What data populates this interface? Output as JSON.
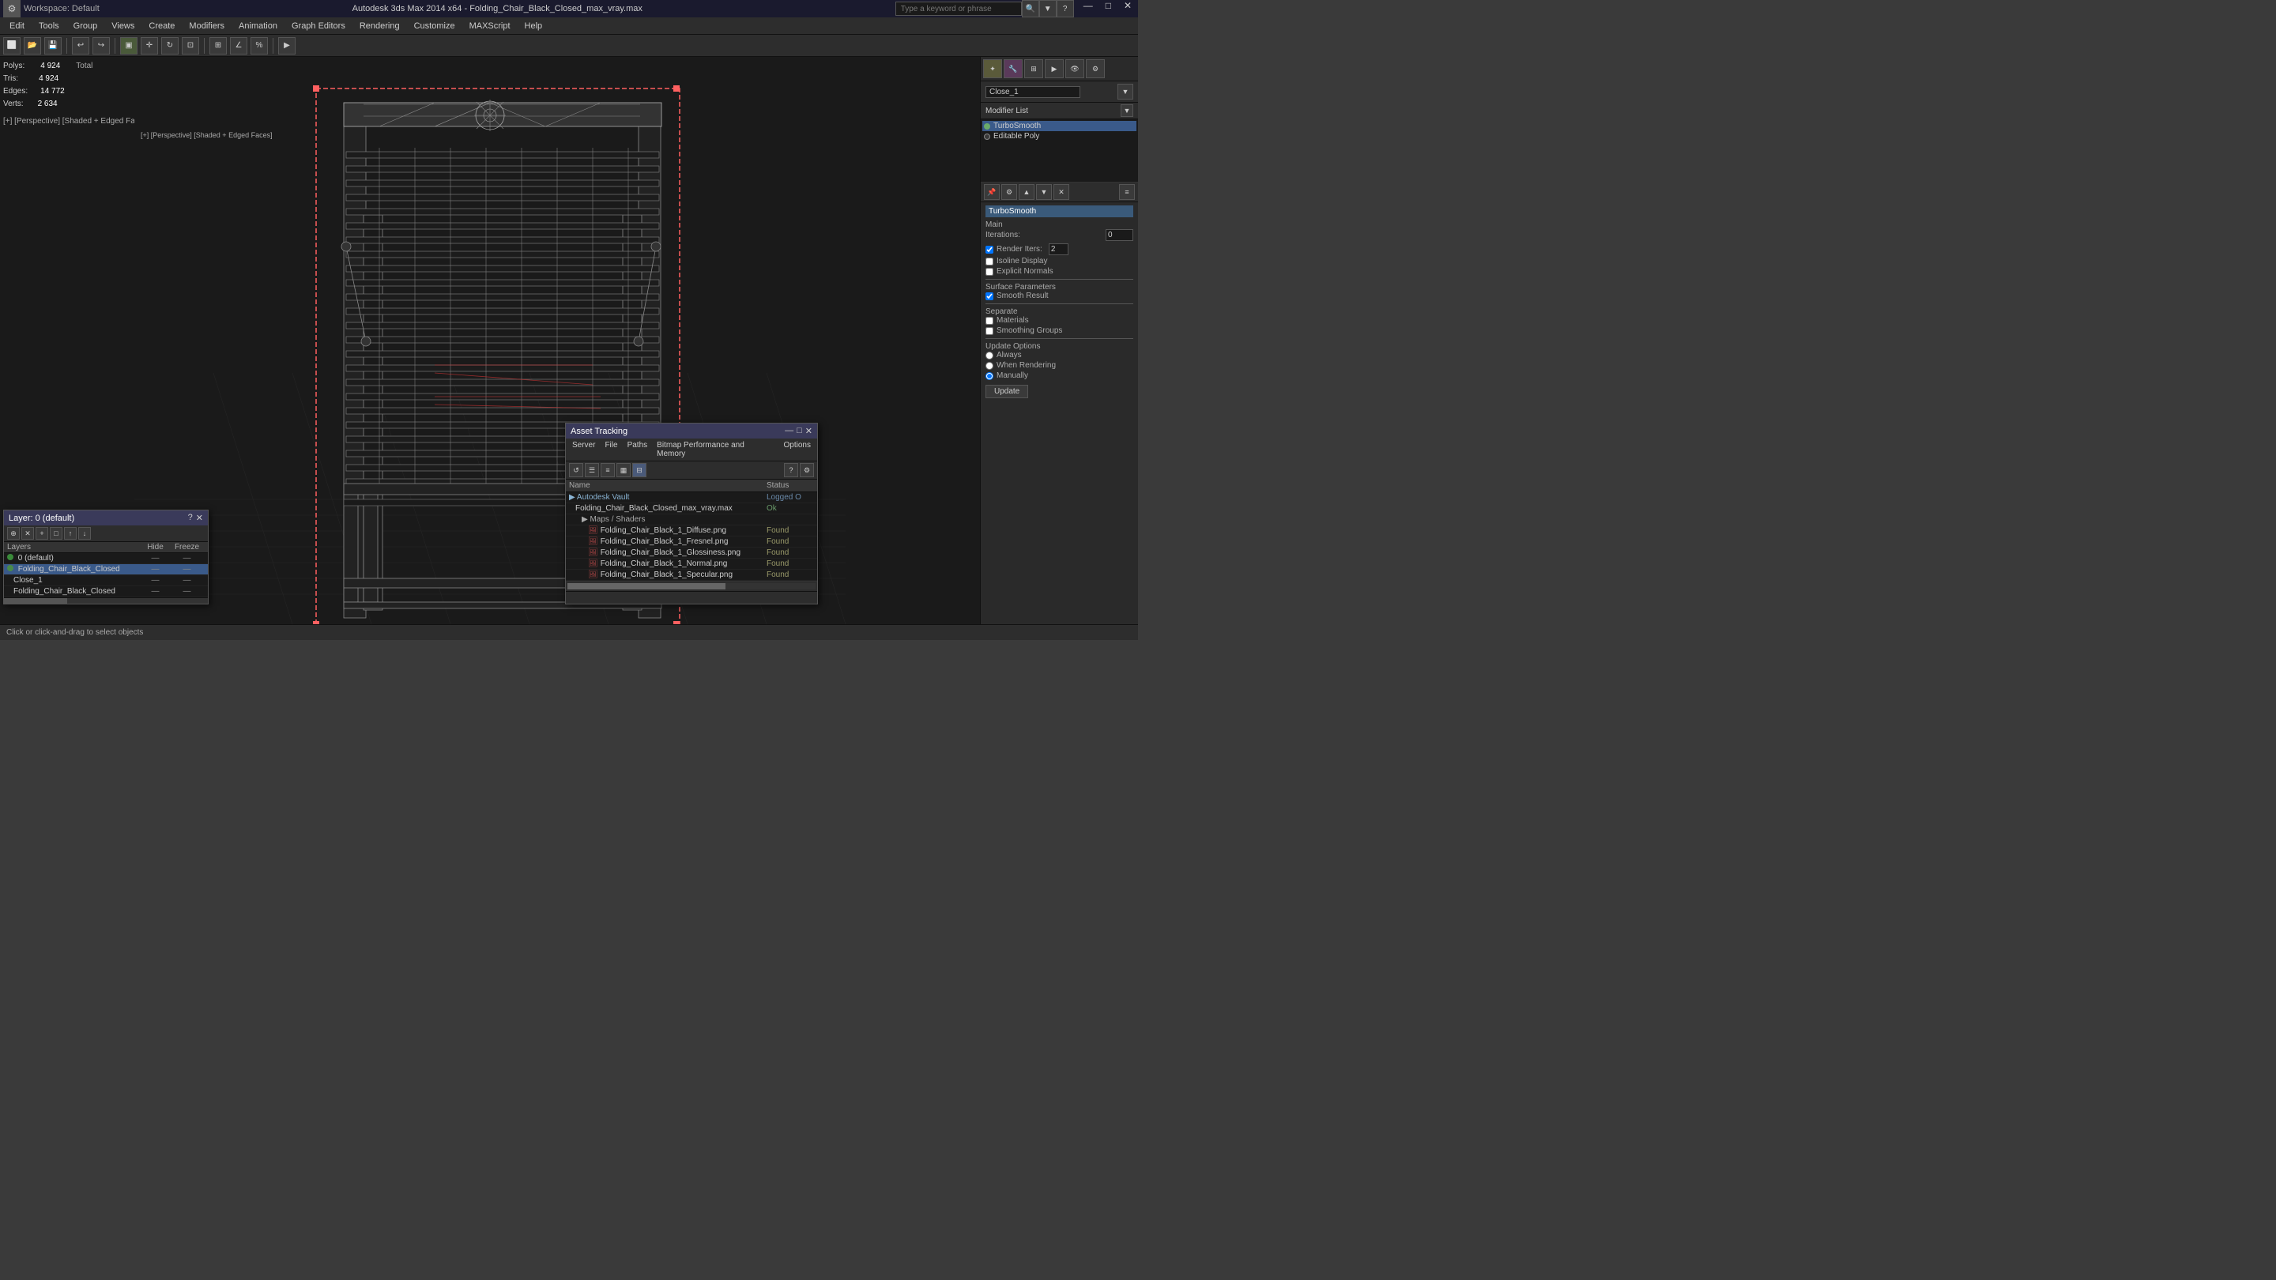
{
  "app": {
    "title": "Autodesk 3ds Max 2014 x64 - Folding_Chair_Black_Closed_max_vray.max",
    "workspace": "Workspace: Default"
  },
  "titlebar": {
    "minimize": "—",
    "maximize": "□",
    "close": "✕",
    "search_placeholder": "Type a keyword or phrase"
  },
  "menubar": {
    "items": [
      "Edit",
      "Tools",
      "Group",
      "Views",
      "Create",
      "Modifiers",
      "Animation",
      "Graph Editors",
      "Rendering",
      "Customize",
      "MAXScript",
      "Help"
    ]
  },
  "viewport": {
    "label": "[+] [Perspective] [Shaded + Edged Faces]",
    "stats": {
      "polys_label": "Polys:",
      "polys_total_label": "Total",
      "polys_value": "4 924",
      "tris_label": "Tris:",
      "tris_value": "4 924",
      "edges_label": "Edges:",
      "edges_value": "14 772",
      "verts_label": "Verts:",
      "verts_value": "2 634"
    }
  },
  "right_panel": {
    "modifier_name": "Close_1",
    "modifier_list_label": "Modifier List",
    "modifiers": [
      {
        "name": "TurboSmooth",
        "active": true
      },
      {
        "name": "Editable Poly",
        "active": false
      }
    ],
    "turbosmooth": {
      "title": "TurboSmooth",
      "main_label": "Main",
      "iterations_label": "Iterations:",
      "iterations_value": "0",
      "render_iters_label": "Render Iters:",
      "render_iters_value": "2",
      "isoline_label": "Isoline Display",
      "explicit_label": "Explicit Normals",
      "surface_label": "Surface Parameters",
      "smooth_result_label": "Smooth Result",
      "separate_label": "Separate",
      "materials_label": "Materials",
      "smoothing_label": "Smoothing Groups",
      "update_label": "Update Options",
      "always_label": "Always",
      "when_rendering_label": "When Rendering",
      "manually_label": "Manually",
      "update_btn": "Update"
    }
  },
  "asset_tracking": {
    "title": "Asset Tracking",
    "menus": [
      "Server",
      "File",
      "Paths",
      "Bitmap Performance and Memory",
      "Options"
    ],
    "table_headers": [
      "Name",
      "Status"
    ],
    "rows": [
      {
        "indent": 0,
        "type": "group",
        "name": "Autodesk Vault",
        "status": "Logged O"
      },
      {
        "indent": 1,
        "type": "file",
        "name": "Folding_Chair_Black_Closed_max_vray.max",
        "status": "Ok"
      },
      {
        "indent": 2,
        "type": "subgroup",
        "name": "Maps / Shaders",
        "status": ""
      },
      {
        "indent": 3,
        "type": "asset",
        "name": "Folding_Chair_Black_1_Diffuse.png",
        "status": "Found"
      },
      {
        "indent": 3,
        "type": "asset",
        "name": "Folding_Chair_Black_1_Fresnel.png",
        "status": "Found"
      },
      {
        "indent": 3,
        "type": "asset",
        "name": "Folding_Chair_Black_1_Glossiness.png",
        "status": "Found"
      },
      {
        "indent": 3,
        "type": "asset",
        "name": "Folding_Chair_Black_1_Normal.png",
        "status": "Found"
      },
      {
        "indent": 3,
        "type": "asset",
        "name": "Folding_Chair_Black_1_Specular.png",
        "status": "Found"
      }
    ]
  },
  "layer_panel": {
    "title": "Layer: 0 (default)",
    "headers": [
      "Layers",
      "Hide",
      "Freeze"
    ],
    "rows": [
      {
        "name": "0 (default)",
        "hide": "—",
        "freeze": "—",
        "indent": 0,
        "active": true
      },
      {
        "name": "Folding_Chair_Black_Closed",
        "hide": "—",
        "freeze": "—",
        "indent": 0,
        "selected": true
      },
      {
        "name": "Close_1",
        "hide": "—",
        "freeze": "—",
        "indent": 1
      },
      {
        "name": "Folding_Chair_Black_Closed",
        "hide": "—",
        "freeze": "—",
        "indent": 1
      }
    ]
  },
  "statusbar": {
    "text": "Click or click-and-drag to select objects"
  },
  "icons": {
    "collapse": "▼",
    "expand": "▶",
    "close": "✕",
    "minimize": "—",
    "restore": "□",
    "settings": "⚙",
    "search": "🔍",
    "folder": "📁",
    "refresh": "↺",
    "lock": "🔒",
    "eye": "👁",
    "pin": "📌",
    "grid": "▦",
    "list": "☰",
    "details": "≡",
    "help": "?"
  }
}
